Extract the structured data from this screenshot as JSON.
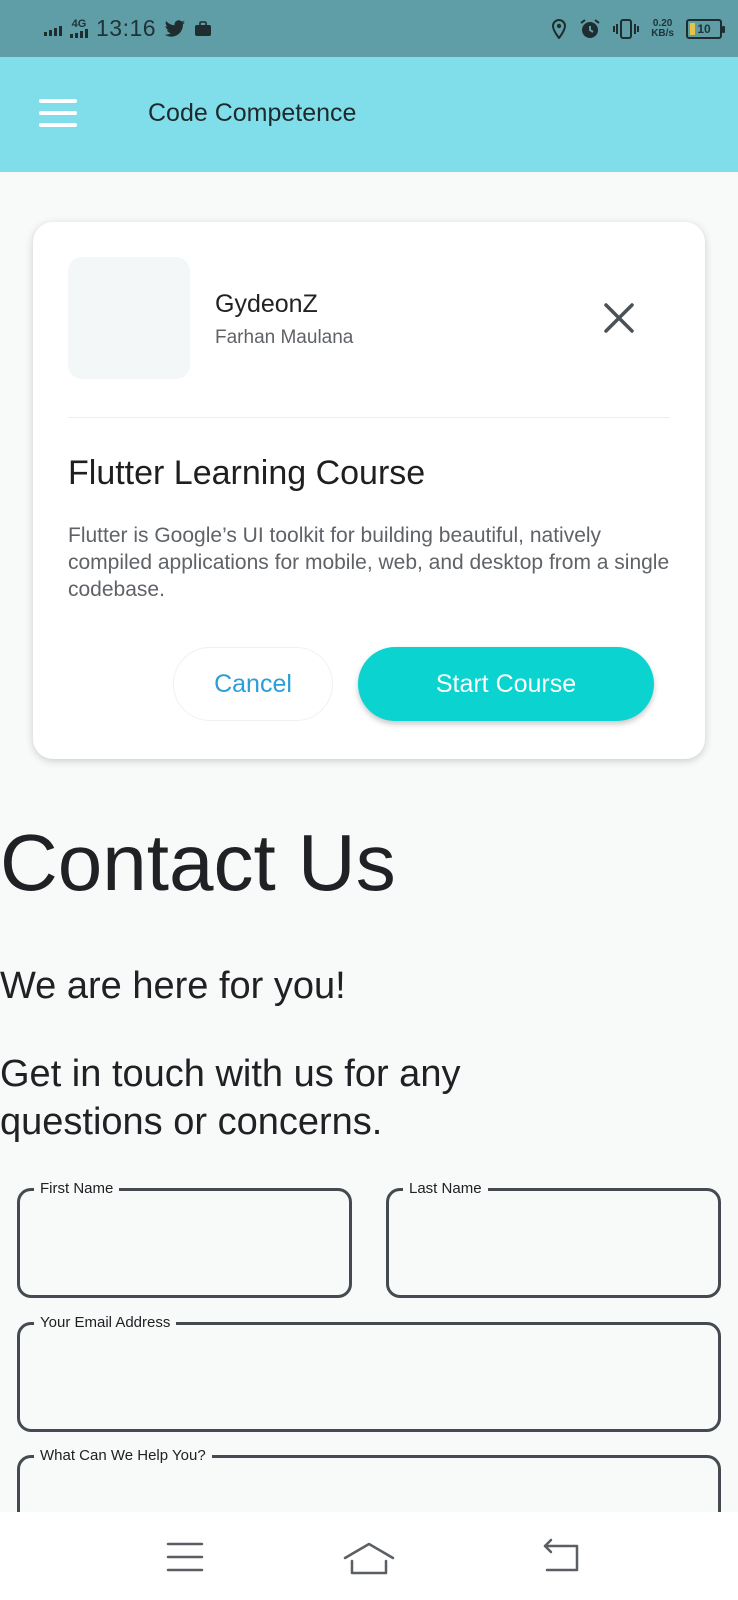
{
  "status_bar": {
    "network": "4G",
    "time": "13:16",
    "speed_value": "0.20",
    "speed_unit": "KB/s",
    "battery": "10",
    "icons": [
      "signal-icon",
      "twitter-icon",
      "briefcase-icon",
      "location-icon",
      "alarm-icon",
      "vibrate-icon",
      "battery-icon"
    ]
  },
  "app_bar": {
    "title": "Code Competence",
    "color": "#80deea"
  },
  "card": {
    "name": "GydeonZ",
    "author": "Farhan Maulana",
    "heading": "Flutter Learning Course",
    "description": "Flutter is Google’s UI toolkit for building beautiful, natively compiled applications for mobile, web, and desktop from a single codebase.",
    "cancel_label": "Cancel",
    "start_label": "Start Course",
    "accent": "#0bd3d0"
  },
  "contact": {
    "title": "Contact Us",
    "subtitle": "We are here for you!",
    "text": "Get in touch with us for any questions or concerns.",
    "fields": {
      "first_name": "First Name",
      "last_name": "Last Name",
      "email": "Your Email Address",
      "help": "What Can We Help You?"
    }
  },
  "nav_bar": {
    "icons": [
      "menu-icon",
      "home-icon",
      "back-icon"
    ]
  }
}
